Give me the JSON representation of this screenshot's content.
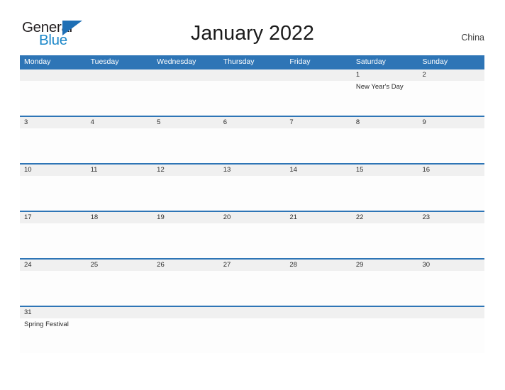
{
  "brand": {
    "word_one": "General",
    "word_two": "Blue",
    "flag_icon": "triangle-flag-icon",
    "color_dark": "#231f20",
    "color_blue": "#1b87c9",
    "color_flag": "#1e6fb5"
  },
  "header": {
    "title": "January 2022",
    "region": "China"
  },
  "colors": {
    "header_blue": "#2e75b6",
    "daynum_gray": "#f0f0f0",
    "divider_blue": "#2e75b6",
    "text_dark": "#2b2b2b",
    "page_bg": "#ffffff"
  },
  "calendar": {
    "weekdays": [
      "Monday",
      "Tuesday",
      "Wednesday",
      "Thursday",
      "Friday",
      "Saturday",
      "Sunday"
    ],
    "weeks": [
      {
        "days": [
          {
            "num": "",
            "event": ""
          },
          {
            "num": "",
            "event": ""
          },
          {
            "num": "",
            "event": ""
          },
          {
            "num": "",
            "event": ""
          },
          {
            "num": "",
            "event": ""
          },
          {
            "num": "1",
            "event": "New Year's Day"
          },
          {
            "num": "2",
            "event": ""
          }
        ]
      },
      {
        "days": [
          {
            "num": "3",
            "event": ""
          },
          {
            "num": "4",
            "event": ""
          },
          {
            "num": "5",
            "event": ""
          },
          {
            "num": "6",
            "event": ""
          },
          {
            "num": "7",
            "event": ""
          },
          {
            "num": "8",
            "event": ""
          },
          {
            "num": "9",
            "event": ""
          }
        ]
      },
      {
        "days": [
          {
            "num": "10",
            "event": ""
          },
          {
            "num": "11",
            "event": ""
          },
          {
            "num": "12",
            "event": ""
          },
          {
            "num": "13",
            "event": ""
          },
          {
            "num": "14",
            "event": ""
          },
          {
            "num": "15",
            "event": ""
          },
          {
            "num": "16",
            "event": ""
          }
        ]
      },
      {
        "days": [
          {
            "num": "17",
            "event": ""
          },
          {
            "num": "18",
            "event": ""
          },
          {
            "num": "19",
            "event": ""
          },
          {
            "num": "20",
            "event": ""
          },
          {
            "num": "21",
            "event": ""
          },
          {
            "num": "22",
            "event": ""
          },
          {
            "num": "23",
            "event": ""
          }
        ]
      },
      {
        "days": [
          {
            "num": "24",
            "event": ""
          },
          {
            "num": "25",
            "event": ""
          },
          {
            "num": "26",
            "event": ""
          },
          {
            "num": "27",
            "event": ""
          },
          {
            "num": "28",
            "event": ""
          },
          {
            "num": "29",
            "event": ""
          },
          {
            "num": "30",
            "event": ""
          }
        ]
      },
      {
        "days": [
          {
            "num": "31",
            "event": "Spring Festival"
          },
          {
            "num": "",
            "event": ""
          },
          {
            "num": "",
            "event": ""
          },
          {
            "num": "",
            "event": ""
          },
          {
            "num": "",
            "event": ""
          },
          {
            "num": "",
            "event": ""
          },
          {
            "num": "",
            "event": ""
          }
        ]
      }
    ]
  }
}
